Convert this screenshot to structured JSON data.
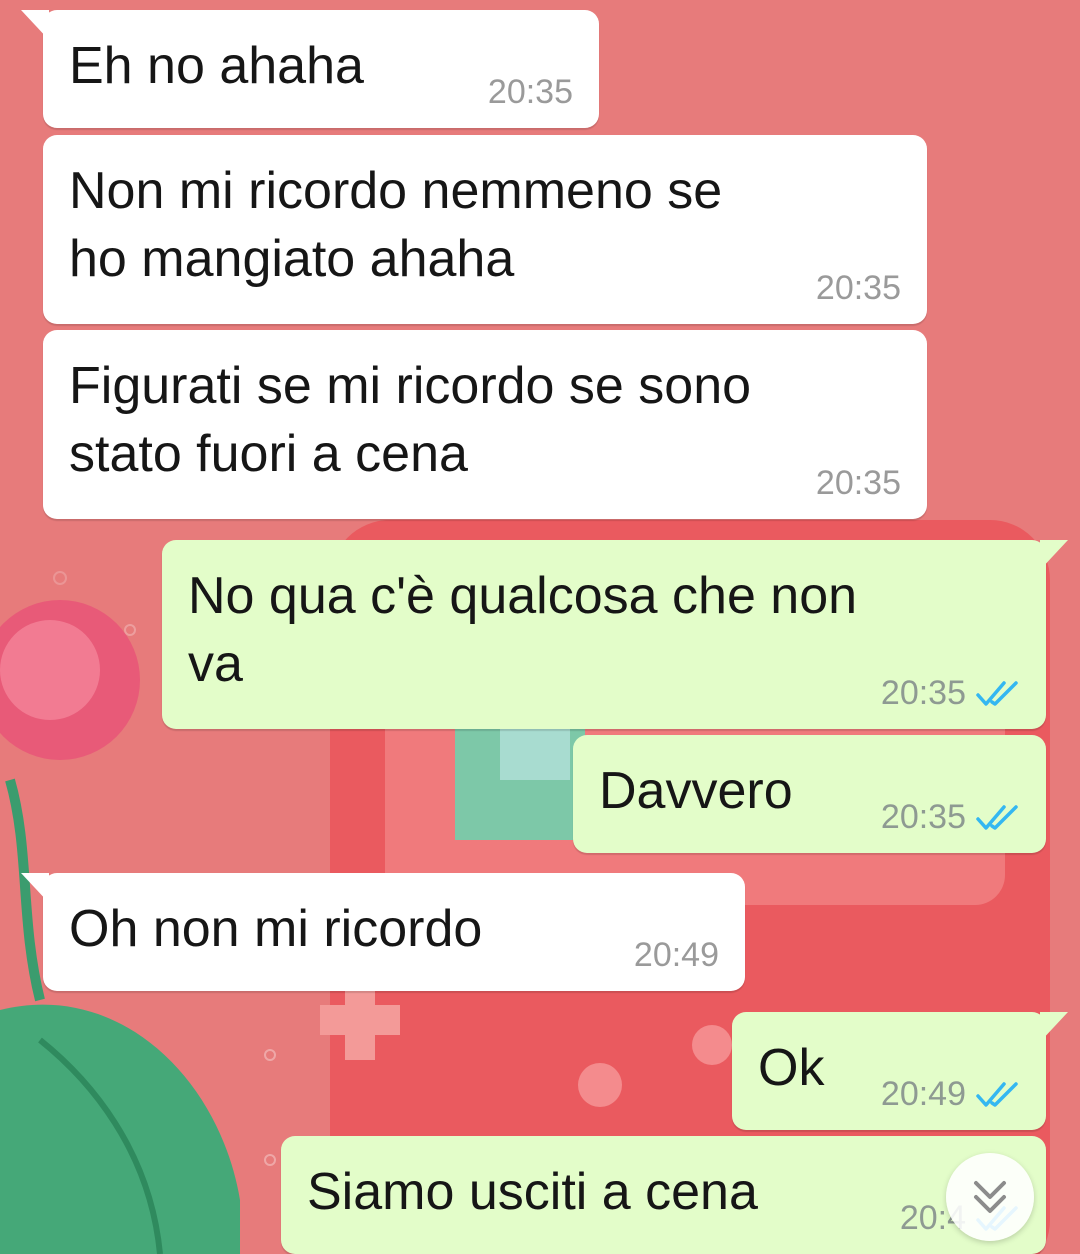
{
  "colors": {
    "wallpaper": "#e77b7b",
    "incoming_bubble": "#ffffff",
    "outgoing_bubble": "#e3fdc9",
    "read_tick": "#34b7f1"
  },
  "messages": [
    {
      "direction": "incoming",
      "text": "Eh no ahaha",
      "time": "20:35"
    },
    {
      "direction": "incoming",
      "text": "Non mi ricordo nemmeno se\nho mangiato ahaha",
      "time": "20:35"
    },
    {
      "direction": "incoming",
      "text": "Figurati se mi ricordo se sono\nstato fuori a cena",
      "time": "20:35"
    },
    {
      "direction": "outgoing",
      "text": "No qua c'è qualcosa che non\nva",
      "time": "20:35",
      "status": "read-double-check-icon"
    },
    {
      "direction": "outgoing",
      "text": "Davvero",
      "time": "20:35",
      "status": "read-double-check-icon"
    },
    {
      "direction": "incoming",
      "text": "Oh non mi ricordo",
      "time": "20:49"
    },
    {
      "direction": "outgoing",
      "text": "Ok",
      "time": "20:49",
      "status": "read-double-check-icon"
    },
    {
      "direction": "outgoing",
      "text": "Siamo usciti a cena",
      "time": "20:4",
      "status": "read-double-check-icon"
    }
  ],
  "scroll_button": {
    "icon": "double-chevron-down-icon"
  }
}
